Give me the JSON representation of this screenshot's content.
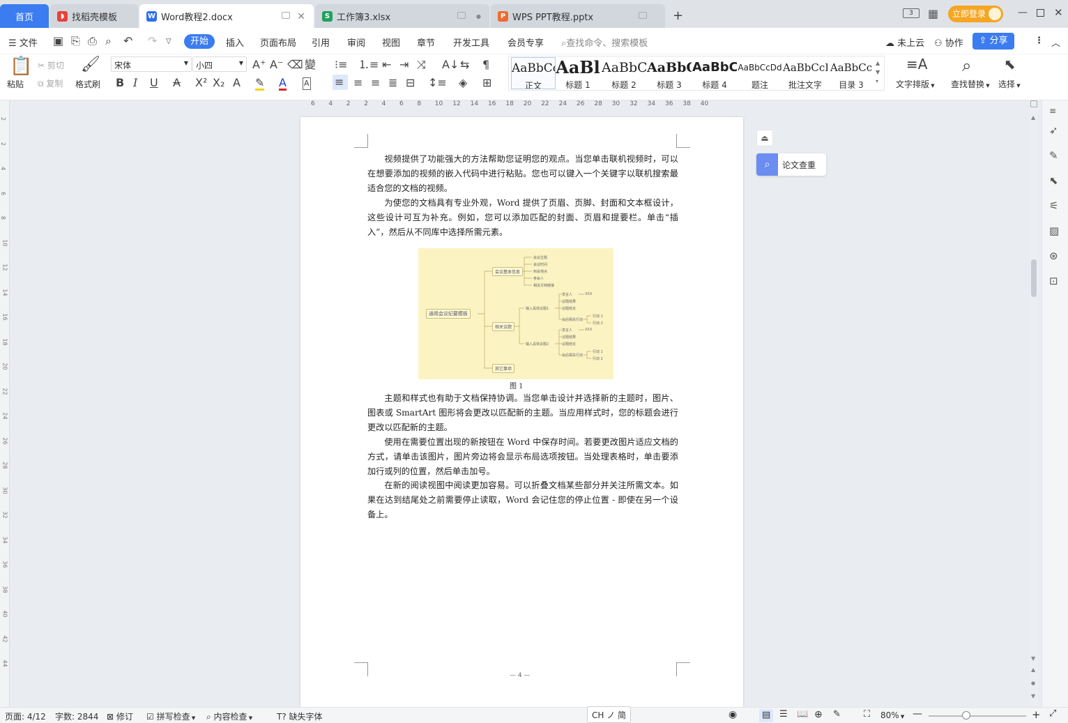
{
  "tabs": {
    "home": "首页",
    "daoke": "找稻壳模板",
    "word": "Word教程2.docx",
    "xlsx": "工作簿3.xlsx",
    "pptx": "WPS PPT教程.pptx"
  },
  "window": {
    "login": "立即登录"
  },
  "menu": {
    "file": "文件",
    "items": [
      "开始",
      "插入",
      "页面布局",
      "引用",
      "审阅",
      "视图",
      "章节",
      "开发工具",
      "会员专享"
    ],
    "search_placeholder": "查找命令、搜索模板",
    "cloud": "未上云",
    "collab": "协作",
    "share": "分享"
  },
  "ribbon": {
    "paste": "粘贴",
    "cut": "剪切",
    "copy": "复制",
    "format_painter": "格式刷",
    "font_name": "宋体",
    "font_size": "小四",
    "styles": [
      {
        "preview": "AaBbCcI",
        "label": "正文"
      },
      {
        "preview": "AaBl",
        "label": "标题 1"
      },
      {
        "preview": "AaBbC",
        "label": "标题 2"
      },
      {
        "preview": "AaBbC",
        "label": "标题 3"
      },
      {
        "preview": "AaBbC",
        "label": "标题 4"
      },
      {
        "preview": "AaBbCcDd",
        "label": "题注"
      },
      {
        "preview": "AaBbCcI",
        "label": "批注文字"
      },
      {
        "preview": "AaBbCc",
        "label": "目录 3"
      }
    ],
    "text_layout": "文字排版",
    "find_replace": "查找替换",
    "select": "选择"
  },
  "ruler": {
    "ticks": [
      "6",
      "4",
      "2",
      "2",
      "4",
      "6",
      "8",
      "10",
      "12",
      "14",
      "16",
      "18",
      "20",
      "22",
      "24",
      "26",
      "28",
      "30",
      "32",
      "34",
      "36",
      "38",
      "40"
    ]
  },
  "vruler": {
    "ticks": [
      "2",
      "2",
      "4",
      "6",
      "8",
      "10",
      "12",
      "14",
      "16",
      "18",
      "20",
      "22",
      "24",
      "26",
      "28",
      "30",
      "32",
      "34",
      "36",
      "38",
      "40",
      "42",
      "44"
    ]
  },
  "document": {
    "paragraphs": [
      "视频提供了功能强大的方法帮助您证明您的观点。当您单击联机视频时，可以在想要添加的视频的嵌入代码中进行粘贴。您也可以键入一个关键字以联机搜索最适合您的文档的视频。",
      "为使您的文档具有专业外观，Word 提供了页眉、页脚、封面和文本框设计，这些设计可互为补充。例如，您可以添加匹配的封面、页眉和提要栏。单击“插入”，然后从不同库中选择所需元素。",
      "主题和样式也有助于文档保持协调。当您单击设计并选择新的主题时，图片、图表或 SmartArt 图形将会更改以匹配新的主题。当应用样式时，您的标题会进行更改以匹配新的主题。",
      "使用在需要位置出现的新按钮在 Word 中保存时间。若要更改图片适应文档的方式，请单击该图片，图片旁边将会显示布局选项按钮。当处理表格时，单击要添加行或列的位置，然后单击加号。",
      "在新的阅读视图中阅读更加容易。可以折叠文档某些部分并关注所需文本。如果在达到结尾处之前需要停止读取，Word 会记住您的停止位置 - 即使在另一个设备上。"
    ],
    "caption": "图 1",
    "page_number": "— 4 —",
    "mindmap": {
      "root": "通用会议纪要模板",
      "branch1": "会议基本信息",
      "branch2": "相关议题",
      "branch3": "其它事项",
      "b1_items": [
        "会议主题",
        "会议时间",
        "到会地点",
        "参会人",
        "相关文档链接"
      ],
      "sub1": "输入具体议题1",
      "sub2": "输入具体议题2",
      "sub_items": [
        "发言人",
        "议题结果",
        "议题结论",
        "会后相关行动"
      ],
      "xxx": "XXX",
      "actions": [
        "行动 1",
        "行动 2"
      ]
    }
  },
  "side_panel": {
    "plagiarism": "论文查重"
  },
  "status": {
    "page": "页面: 4/12",
    "words": "字数: 2844",
    "revise": "修订",
    "spell": "拼写检查",
    "content_check": "内容检查",
    "missing_font": "缺失字体",
    "ime": "CH ノ 简",
    "zoom": "80%"
  }
}
